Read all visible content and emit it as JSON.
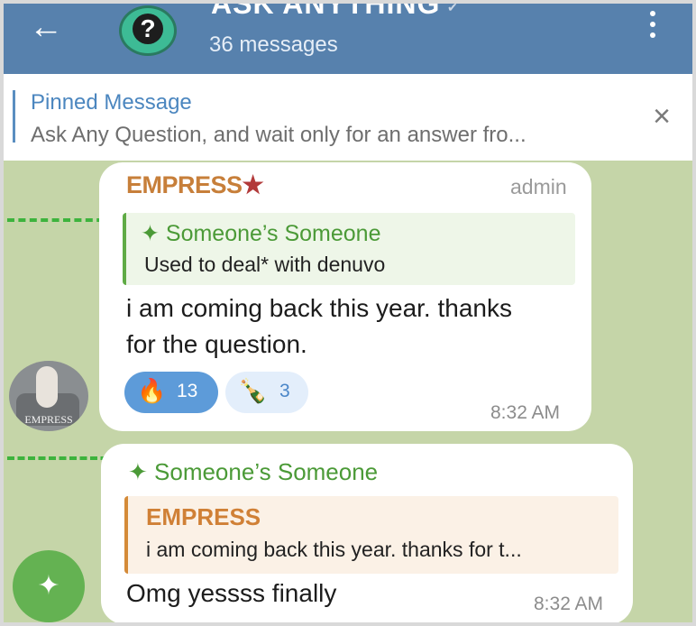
{
  "header": {
    "title": "ASK ANYTHING",
    "subtitle": "36 messages",
    "back_icon": "arrow-left-icon",
    "avatar_icon": "question-mark-icon",
    "menu_icon": "more-vertical-icon",
    "accent": "#5781ad"
  },
  "pinned": {
    "title": "Pinned Message",
    "text": "Ask Any Question, and wait only for an answer fro...",
    "close_icon": "close-icon"
  },
  "messages": [
    {
      "sender": "EMPRESS",
      "sender_badge": "★",
      "role": "admin",
      "reply_to": {
        "name": "Someone’s Someone",
        "text": "Used to deal* with denuvo"
      },
      "text_line1": "i am coming back this year. thanks",
      "text_line2": "for the question.",
      "reactions": [
        {
          "emoji": "🔥",
          "count": "13"
        },
        {
          "emoji": "🍾",
          "count": "3"
        }
      ],
      "time": "8:32 AM",
      "avatar_label": "EMPRESS"
    },
    {
      "sender": "Someone’s Someone",
      "reply_to": {
        "name": "EMPRESS",
        "text": "i am coming back this year. thanks for t..."
      },
      "text": "Omg yessss finally",
      "time": "8:32 AM"
    }
  ],
  "colors": {
    "sender_empress": "#c77f3a",
    "sender_someone": "#4b9a37",
    "reaction_active": "#5d9bd9",
    "reaction_inactive": "#e3eefb"
  }
}
